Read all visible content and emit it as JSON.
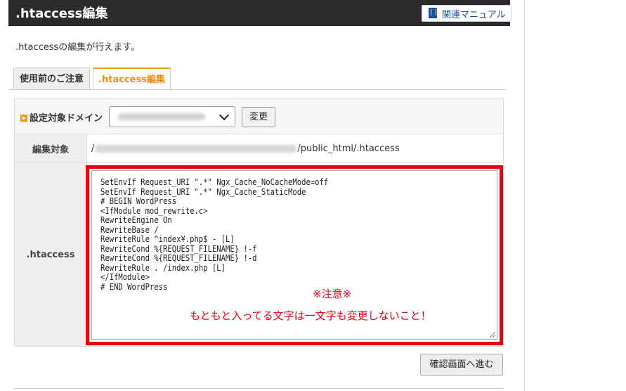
{
  "header": {
    "title": ".htaccess編集",
    "manual_button": "関連マニュアル",
    "manual_icon": "book-icon"
  },
  "description": ".htaccessの編集が行えます。",
  "tabs": [
    {
      "label": "使用前のご注意",
      "active": false
    },
    {
      "label": ".htaccess編集",
      "active": true
    }
  ],
  "form": {
    "domain_label": "設定対象ドメイン",
    "change_button": "変更",
    "target_label": "編集対象",
    "target_path_prefix": "/",
    "target_path_suffix": "/public_html/.htaccess",
    "htaccess_label": ".htaccess",
    "htaccess_content": "SetEnvIf Request_URI \".*\" Ngx_Cache_NoCacheMode=off\nSetEnvIf Request_URI \".*\" Ngx_Cache_StaticMode\n# BEGIN WordPress\n<IfModule mod_rewrite.c>\nRewriteEngine On\nRewriteBase /\nRewriteRule ^index¥.php$ - [L]\nRewriteCond %{REQUEST_FILENAME} !-f\nRewriteCond %{REQUEST_FILENAME} !-d\nRewriteRule . /index.php [L]\n</IfModule>\n# END WordPress"
  },
  "annotation": {
    "title": "※注意※",
    "message": "もともと入ってる文字は一文字も変更しないこと！",
    "color": "#e60012"
  },
  "confirm_button": "確認画面へ進む",
  "colors": {
    "accent": "#f39800",
    "header_bg": "#2b2b2b",
    "link": "#1d4fa0"
  }
}
